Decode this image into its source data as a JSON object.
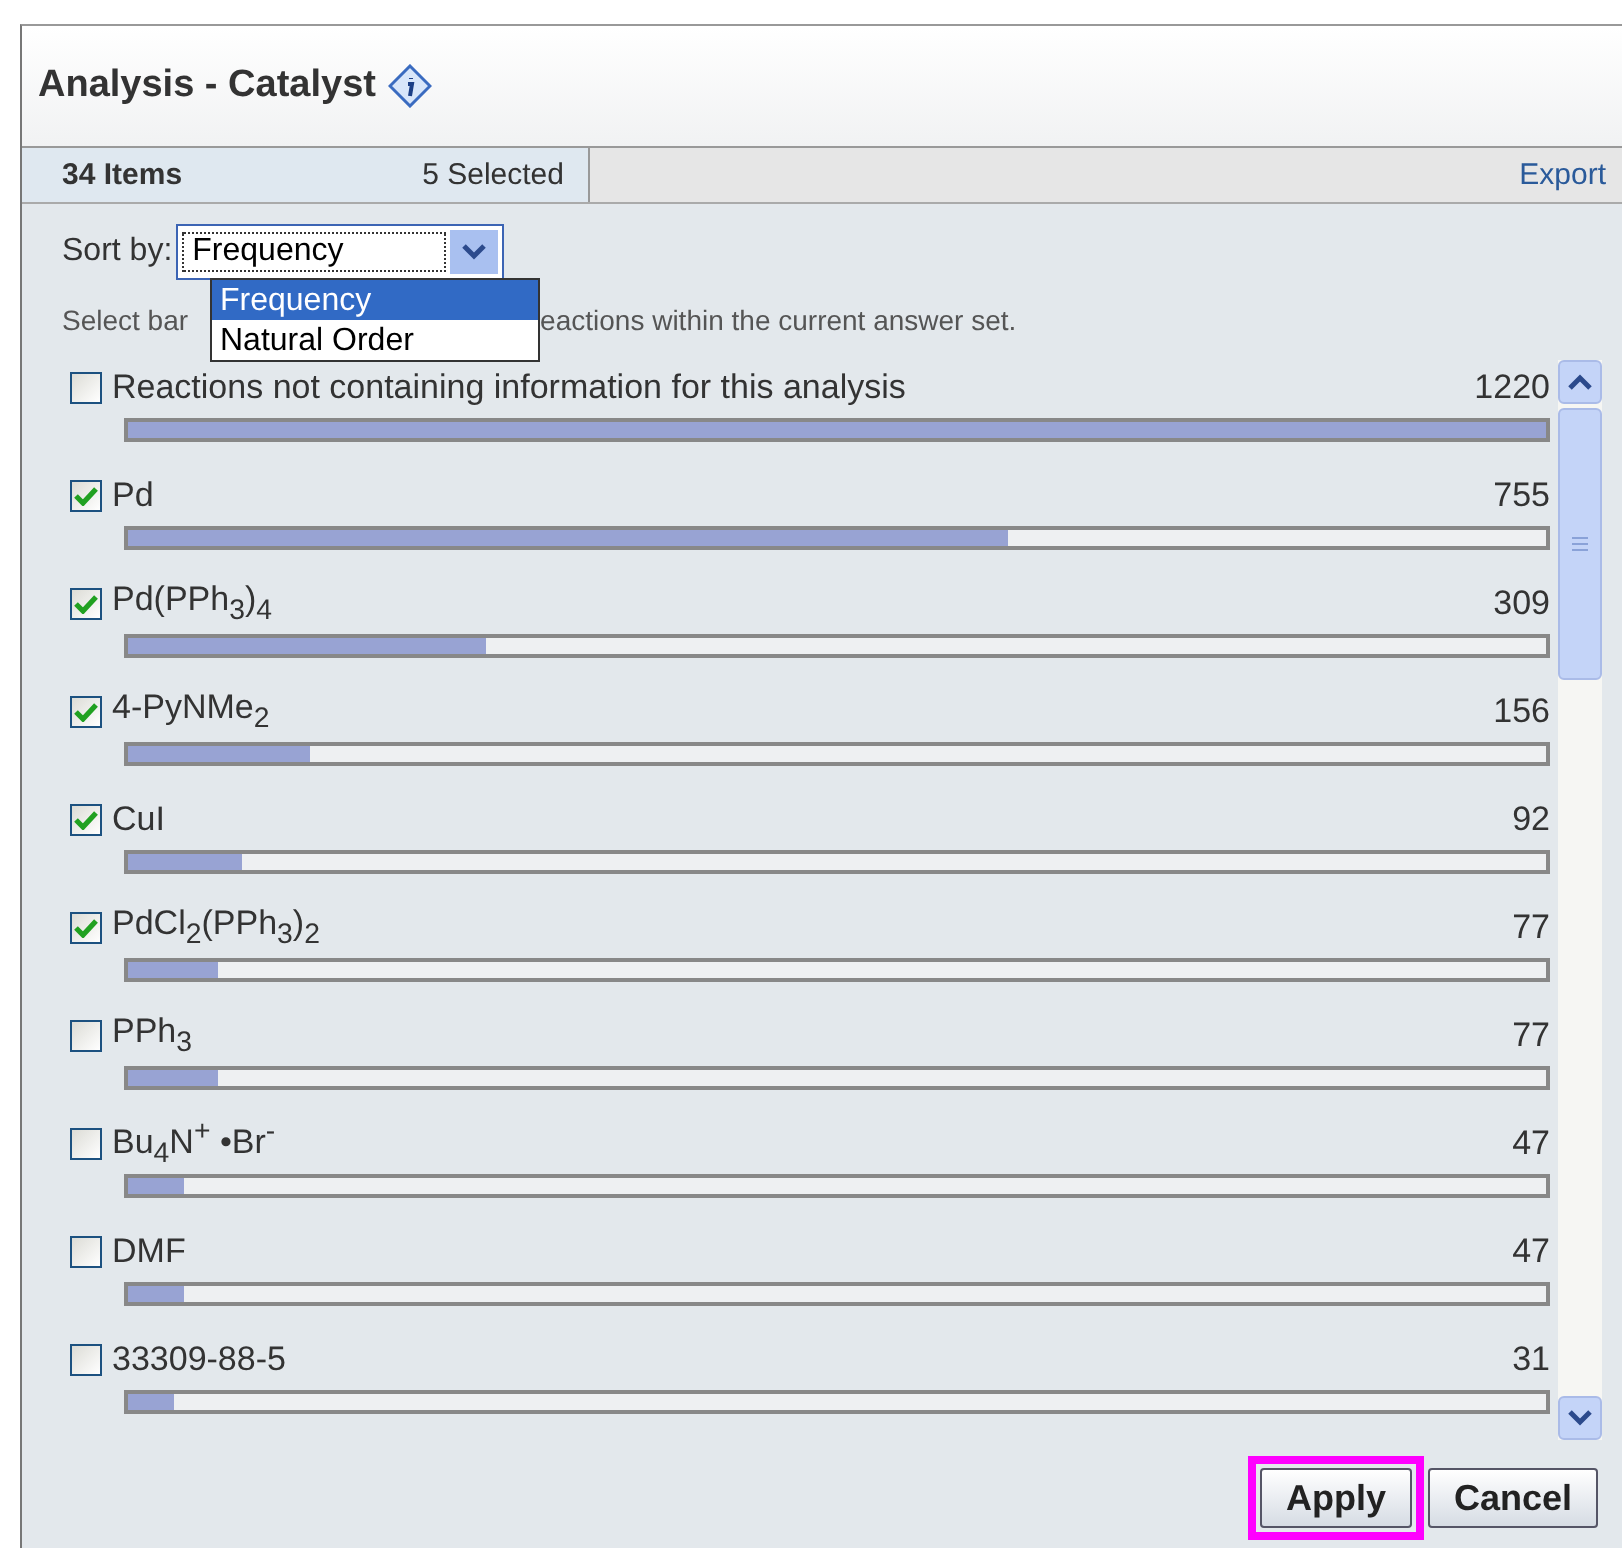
{
  "panel": {
    "title": "Analysis - Catalyst"
  },
  "tabs": {
    "items_count": "34 Items",
    "selected_count": "5 Selected",
    "export_link": "Export"
  },
  "sort": {
    "label": "Sort by:",
    "value": "Frequency",
    "expanded": true,
    "options": [
      {
        "label": "Frequency",
        "selected": true
      },
      {
        "label": "Natural Order",
        "selected": false
      }
    ]
  },
  "hint": [
    "Select bar",
    "eactions within the current answer set."
  ],
  "items": [
    {
      "label": "Reactions not containing information for this analysis",
      "count": "1220",
      "checked": false,
      "level": 1.0
    },
    {
      "label": "Pd",
      "count": "755",
      "checked": true,
      "level": 0.62
    },
    {
      "label": "Pd(PPh$_{3}$)$_{4}$",
      "count": "309",
      "checked": true,
      "level": 0.253
    },
    {
      "label": "4-PyNMe$_{2}$",
      "count": "156",
      "checked": true,
      "level": 0.128
    },
    {
      "label": "CuI",
      "count": "92",
      "checked": true,
      "level": 0.08
    },
    {
      "label": "PdCl$_{2}$(PPh$_{3}$)$_{2}$",
      "count": "77",
      "checked": true,
      "level": 0.063
    },
    {
      "label": "PPh$_{3}$",
      "count": "77",
      "checked": false,
      "level": 0.063
    },
    {
      "label": "Bu$_{4}$N$^{+}$ •Br$^{-}$",
      "count": "47",
      "checked": false,
      "level": 0.04
    },
    {
      "label": "DMF",
      "count": "47",
      "checked": false,
      "level": 0.04
    },
    {
      "label": "33309-88-5",
      "count": "31",
      "checked": false,
      "level": 0.032
    }
  ],
  "buttons": [
    {
      "label": "Apply",
      "highlighted": true
    },
    {
      "label": "Cancel",
      "highlighted": false
    }
  ]
}
